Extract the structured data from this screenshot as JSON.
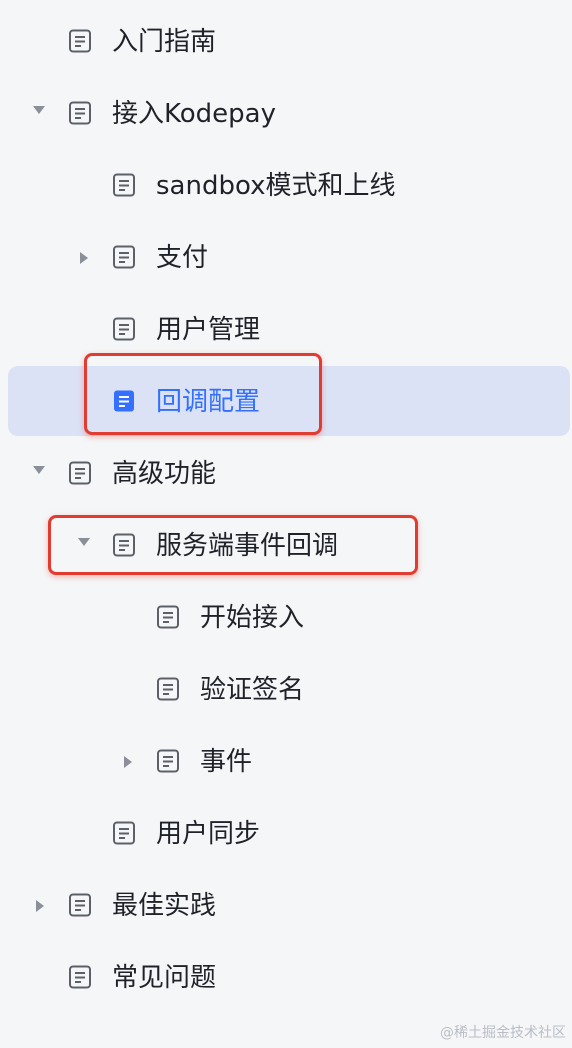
{
  "tree": {
    "items": [
      {
        "label": "入门指南",
        "expander": "none",
        "icon": "doc-icon"
      },
      {
        "label": "接入Kodepay",
        "expander": "expanded",
        "icon": "doc-icon"
      },
      {
        "label": "sandbox模式和上线",
        "expander": "none",
        "icon": "doc-icon"
      },
      {
        "label": "支付",
        "expander": "collapsed",
        "icon": "doc-icon"
      },
      {
        "label": "用户管理",
        "expander": "none",
        "icon": "doc-icon"
      },
      {
        "label": "回调配置",
        "expander": "none",
        "icon": "doc-icon-filled",
        "selected": true
      },
      {
        "label": "高级功能",
        "expander": "expanded",
        "icon": "doc-icon"
      },
      {
        "label": "服务端事件回调",
        "expander": "expanded",
        "icon": "doc-icon"
      },
      {
        "label": "开始接入",
        "expander": "none",
        "icon": "doc-icon"
      },
      {
        "label": "验证签名",
        "expander": "none",
        "icon": "doc-icon"
      },
      {
        "label": "事件",
        "expander": "collapsed",
        "icon": "doc-icon"
      },
      {
        "label": "用户同步",
        "expander": "none",
        "icon": "doc-icon"
      },
      {
        "label": "最佳实践",
        "expander": "collapsed",
        "icon": "doc-icon"
      },
      {
        "label": "常见问题",
        "expander": "none",
        "icon": "doc-icon"
      }
    ]
  },
  "colors": {
    "selected_text": "#3370ff",
    "selected_bg": "#dbe2f6",
    "annotation": "#e23b2f"
  },
  "watermark": "@稀土掘金技术社区"
}
